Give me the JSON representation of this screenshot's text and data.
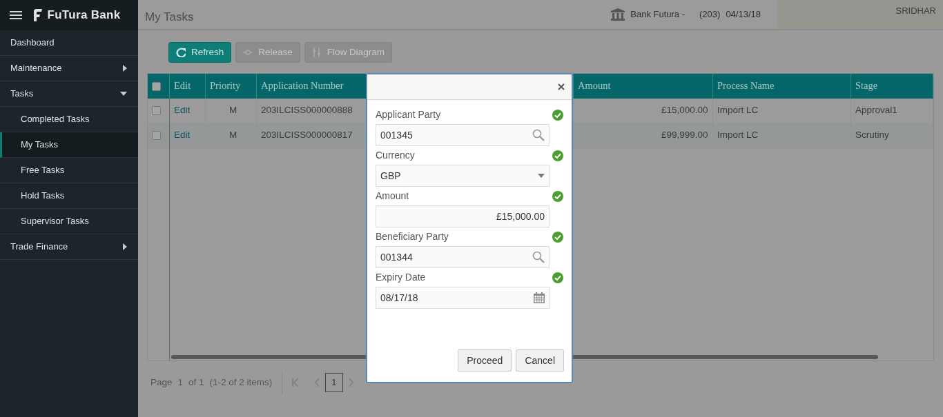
{
  "app": {
    "name": "FuTura Bank"
  },
  "page_title": "My Tasks",
  "header": {
    "branch": "Bank Futura -",
    "branch_code": "(203)",
    "date": "04/13/18",
    "user": "SRIDHAR"
  },
  "sidebar": {
    "items": [
      {
        "label": "Dashboard",
        "kind": "link"
      },
      {
        "label": "Maintenance",
        "kind": "group",
        "expanded": false
      },
      {
        "label": "Tasks",
        "kind": "group",
        "expanded": true,
        "children": [
          {
            "label": "Completed Tasks",
            "selected": false
          },
          {
            "label": "My Tasks",
            "selected": true
          },
          {
            "label": "Free Tasks",
            "selected": false
          },
          {
            "label": "Hold Tasks",
            "selected": false
          },
          {
            "label": "Supervisor Tasks",
            "selected": false
          }
        ]
      },
      {
        "label": "Trade Finance",
        "kind": "group",
        "expanded": false
      }
    ]
  },
  "toolbar": [
    {
      "label": "Refresh",
      "kind": "refresh",
      "disabled": false
    },
    {
      "label": "Release",
      "kind": "release",
      "disabled": true
    },
    {
      "label": "Flow Diagram",
      "kind": "flow",
      "disabled": true
    }
  ],
  "table": {
    "select_all_checked": false,
    "columns": [
      "Edit",
      "Priority",
      "Application Number",
      "Amount",
      "Process Name",
      "Stage"
    ],
    "rows": [
      {
        "checked": false,
        "edit": "Edit",
        "priority": "M",
        "application_number": "203ILCISS000000888",
        "amount": "£15,000.00",
        "process_name": "Import LC",
        "stage": "Approval1"
      },
      {
        "checked": false,
        "edit": "Edit",
        "priority": "M",
        "application_number": "203ILCISS000000817",
        "amount": "£99,999.00",
        "process_name": "Import LC",
        "stage": "Scrutiny"
      }
    ]
  },
  "pager": {
    "page_label": "Page",
    "page": "1",
    "of": "of 1",
    "items": "(1-2 of 2 items)",
    "pages": [
      {
        "label": "1",
        "selected": true
      }
    ]
  },
  "dialog": {
    "fields": [
      {
        "label": "Applicant Party",
        "value": "001345",
        "kind": "lookup",
        "valid": true
      },
      {
        "label": "Currency",
        "value": "GBP",
        "kind": "select",
        "valid": true
      },
      {
        "label": "Amount",
        "value": "£15,000.00",
        "kind": "amount",
        "valid": true
      },
      {
        "label": "Beneficiary Party",
        "value": "001344",
        "kind": "lookup",
        "valid": true
      },
      {
        "label": "Expiry Date",
        "value": "08/17/18",
        "kind": "date",
        "valid": true
      }
    ],
    "buttons": [
      "Proceed",
      "Cancel"
    ]
  }
}
